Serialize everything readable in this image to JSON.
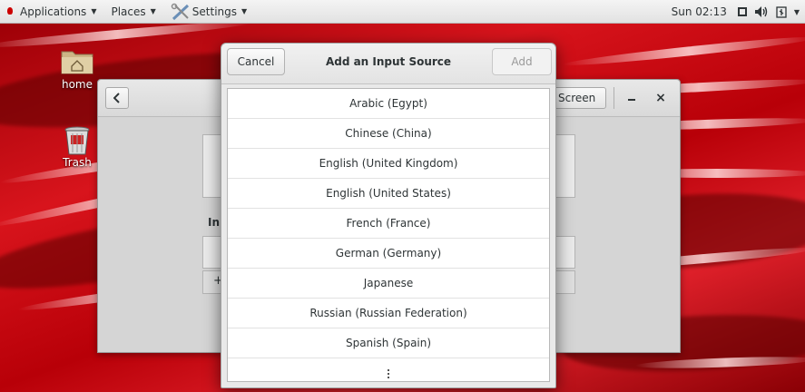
{
  "topbar": {
    "applications_label": "Applications",
    "places_label": "Places",
    "settings_label": "Settings",
    "clock": "Sun 02:13",
    "icons": [
      "display-icon",
      "volume-icon",
      "power-icon"
    ]
  },
  "desktop": {
    "icons": [
      {
        "label": "home",
        "icon": "home-folder-icon"
      },
      {
        "label": "Trash",
        "icon": "trash-icon"
      }
    ]
  },
  "settings_window": {
    "partial_header_button": "Screen",
    "partial_section_label": "In",
    "partial_add_label": "+"
  },
  "dialog": {
    "title": "Add an Input Source",
    "cancel_label": "Cancel",
    "add_label": "Add",
    "add_enabled": false,
    "languages": [
      "Arabic (Egypt)",
      "Chinese (China)",
      "English (United Kingdom)",
      "English (United States)",
      "French (France)",
      "German (Germany)",
      "Japanese",
      "Russian (Russian Federation)",
      "Spanish (Spain)"
    ],
    "more_icon": "more-options-icon"
  },
  "colors": {
    "wallpaper_red": "#c8000c",
    "topbar_bg": "#e8e8e8",
    "dialog_bg": "#e9e9e9"
  }
}
